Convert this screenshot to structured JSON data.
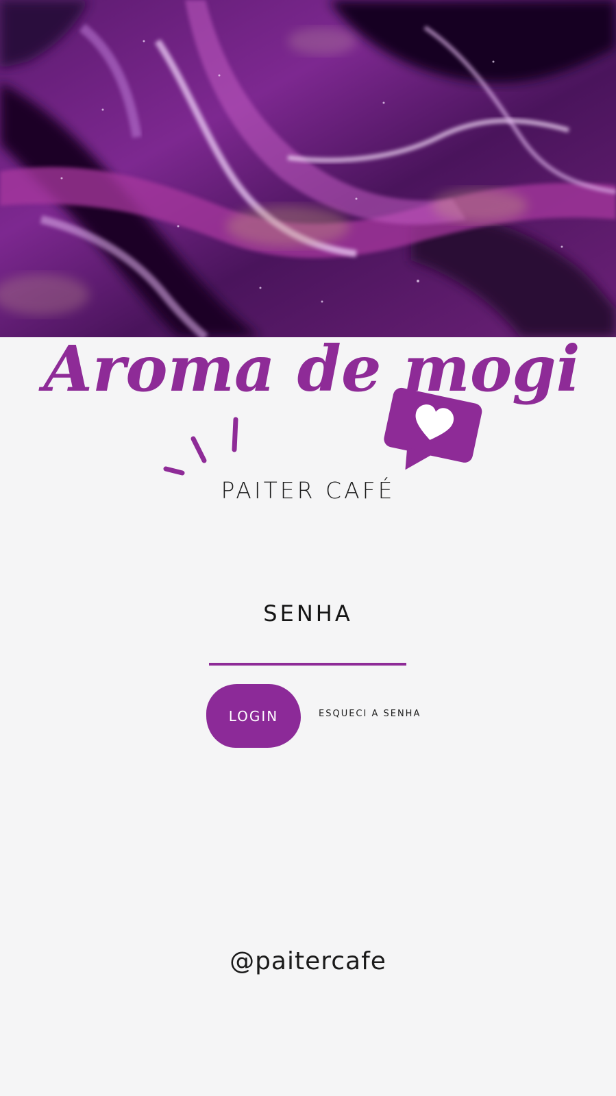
{
  "header": {
    "image_label": "purple-marble-background",
    "script_title": "Aroma de mogi",
    "accent_color": "#8e2b97"
  },
  "brand": {
    "name": "PAITER CAFÉ",
    "icon": "heart-chat-icon"
  },
  "login_form": {
    "password_label": "SENHA",
    "password_value": "",
    "login_button_label": "LOGIN",
    "forgot_password_label": "ESQUECI A SENHA"
  },
  "footer": {
    "handle": "@paitercafe"
  }
}
